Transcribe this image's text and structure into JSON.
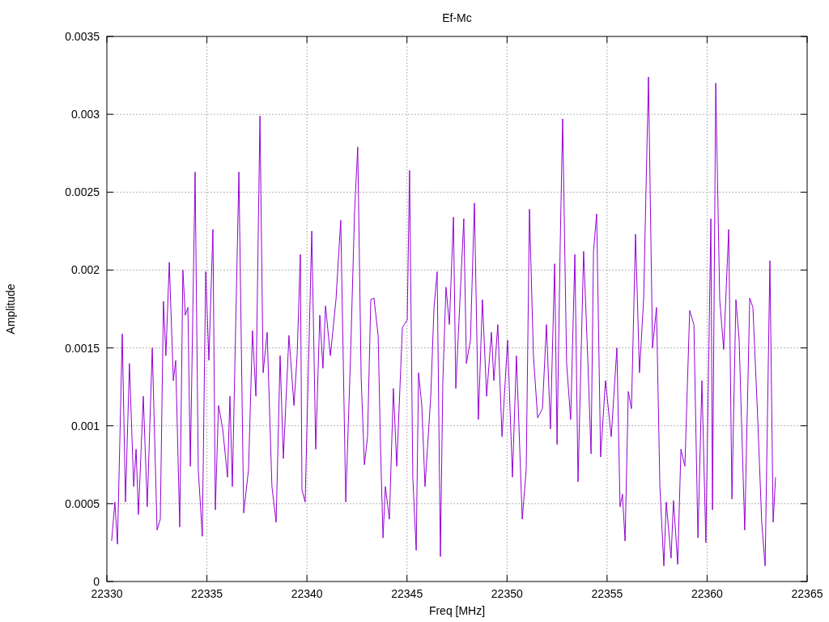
{
  "chart_data": {
    "type": "line",
    "title": "Ef-Mc",
    "xlabel": "Freq [MHz]",
    "ylabel": "Amplitude",
    "xlim": [
      22330,
      22365
    ],
    "ylim": [
      0,
      0.0035
    ],
    "xticks": [
      22330,
      22335,
      22340,
      22345,
      22350,
      22355,
      22360,
      22365
    ],
    "yticks": [
      0,
      0.0005,
      0.001,
      0.0015,
      0.002,
      0.0025,
      0.003,
      0.0035
    ],
    "x": [
      22330.24,
      22330.4,
      22330.53,
      22330.77,
      22330.93,
      22331.13,
      22331.34,
      22331.46,
      22331.58,
      22331.82,
      22332.02,
      22332.27,
      22332.51,
      22332.67,
      22332.83,
      22332.95,
      22333.12,
      22333.32,
      22333.44,
      22333.64,
      22333.8,
      22333.92,
      22334.05,
      22334.17,
      22334.41,
      22334.57,
      22334.77,
      22334.94,
      22335.1,
      22335.3,
      22335.42,
      22335.58,
      22335.79,
      22336.03,
      22336.15,
      22336.27,
      22336.6,
      22336.84,
      22337.08,
      22337.28,
      22337.45,
      22337.65,
      22337.81,
      22338.01,
      22338.25,
      22338.46,
      22338.66,
      22338.82,
      22339.1,
      22339.35,
      22339.51,
      22339.67,
      22339.75,
      22339.91,
      22340.24,
      22340.44,
      22340.64,
      22340.8,
      22340.93,
      22341.17,
      22341.45,
      22341.69,
      22341.94,
      22342.18,
      22342.38,
      22342.54,
      22342.71,
      22342.87,
      22343.03,
      22343.19,
      22343.35,
      22343.56,
      22343.68,
      22343.8,
      22343.92,
      22344.12,
      22344.32,
      22344.49,
      22344.77,
      22345.01,
      22345.13,
      22345.29,
      22345.46,
      22345.58,
      22345.74,
      22345.9,
      22346.19,
      22346.35,
      22346.51,
      22346.67,
      22346.79,
      22346.95,
      22347.12,
      22347.32,
      22347.44,
      22347.72,
      22347.84,
      22347.97,
      22348.17,
      22348.37,
      22348.57,
      22348.77,
      22348.98,
      22349.22,
      22349.34,
      22349.54,
      22349.75,
      22350.03,
      22350.27,
      22350.47,
      22350.76,
      22350.96,
      22351.12,
      22351.32,
      22351.53,
      22351.77,
      22351.97,
      22352.17,
      22352.38,
      22352.5,
      22352.66,
      22352.78,
      22352.98,
      22353.18,
      22353.39,
      22353.55,
      22353.83,
      22354.03,
      22354.2,
      22354.32,
      22354.48,
      22354.68,
      22354.92,
      22355.21,
      22355.49,
      22355.65,
      22355.77,
      22355.9,
      22356.06,
      22356.22,
      22356.42,
      22356.62,
      22356.83,
      22357.07,
      22357.27,
      22357.47,
      22357.64,
      22357.84,
      22357.96,
      22358.2,
      22358.32,
      22358.53,
      22358.69,
      22358.89,
      22359.13,
      22359.34,
      22359.54,
      22359.74,
      22359.94,
      22360.19,
      22360.27,
      22360.43,
      22360.63,
      22360.83,
      22361.08,
      22361.24,
      22361.44,
      22361.6,
      22361.88,
      22362.13,
      22362.29,
      22362.53,
      22362.73,
      22362.9,
      22363.14,
      22363.3,
      22363.42
    ],
    "grid": true,
    "series": [
      {
        "color": "#9400d3",
        "values": [
          0.00026,
          0.00051,
          0.00024,
          0.00159,
          0.00051,
          0.0014,
          0.00061,
          0.00085,
          0.00043,
          0.00119,
          0.00048,
          0.0015,
          0.00033,
          0.0004,
          0.0018,
          0.00145,
          0.00205,
          0.00129,
          0.00142,
          0.00035,
          0.002,
          0.00171,
          0.00176,
          0.00074,
          0.00263,
          0.00072,
          0.00029,
          0.00199,
          0.00142,
          0.00226,
          0.00046,
          0.00113,
          0.00098,
          0.00067,
          0.00119,
          0.00061,
          0.00263,
          0.00044,
          0.00072,
          0.00161,
          0.00119,
          0.00299,
          0.00134,
          0.0016,
          0.00061,
          0.00038,
          0.00145,
          0.00079,
          0.00158,
          0.00113,
          0.00145,
          0.0021,
          0.00059,
          0.00051,
          0.00225,
          0.00085,
          0.00171,
          0.00137,
          0.00177,
          0.00145,
          0.00181,
          0.00232,
          0.00051,
          0.00145,
          0.00238,
          0.00279,
          0.00131,
          0.00075,
          0.00093,
          0.00181,
          0.00182,
          0.00158,
          0.00085,
          0.00028,
          0.00061,
          0.0004,
          0.00124,
          0.00074,
          0.00163,
          0.00168,
          0.00264,
          0.00067,
          0.0002,
          0.00134,
          0.00113,
          0.00061,
          0.00119,
          0.00176,
          0.00199,
          0.00016,
          0.00129,
          0.00189,
          0.00165,
          0.00234,
          0.00124,
          0.002,
          0.00233,
          0.0014,
          0.00155,
          0.00243,
          0.00104,
          0.00181,
          0.00119,
          0.0016,
          0.00129,
          0.00165,
          0.00093,
          0.00155,
          0.00067,
          0.00145,
          0.0004,
          0.00072,
          0.00239,
          0.00145,
          0.00105,
          0.00111,
          0.00165,
          0.00098,
          0.00204,
          0.00088,
          0.00217,
          0.00297,
          0.0014,
          0.00104,
          0.0021,
          0.00064,
          0.00212,
          0.00145,
          0.00082,
          0.00212,
          0.00236,
          0.0008,
          0.00129,
          0.00093,
          0.0015,
          0.00048,
          0.00056,
          0.00026,
          0.00122,
          0.00111,
          0.00223,
          0.00134,
          0.00182,
          0.00324,
          0.0015,
          0.00176,
          0.00061,
          0.0001,
          0.00051,
          0.00015,
          0.00052,
          0.00011,
          0.00085,
          0.00074,
          0.00174,
          0.00165,
          0.00028,
          0.00129,
          0.00025,
          0.00233,
          0.00046,
          0.0032,
          0.00181,
          0.00149,
          0.00226,
          0.00053,
          0.00181,
          0.00155,
          0.00033,
          0.00182,
          0.00176,
          0.00104,
          0.00038,
          0.0001,
          0.00206,
          0.00038,
          0.00067
        ]
      }
    ]
  }
}
